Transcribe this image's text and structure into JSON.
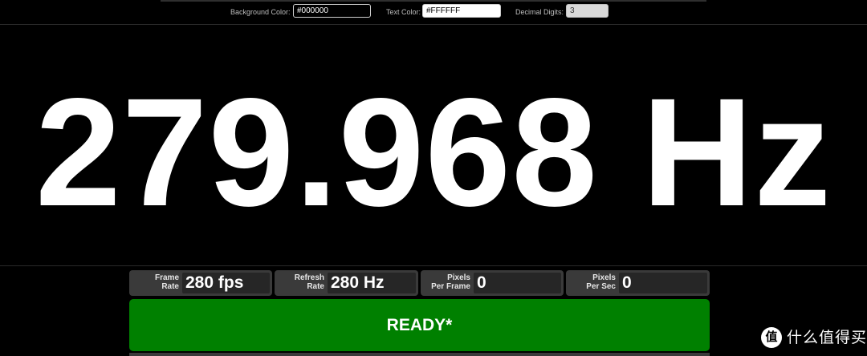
{
  "settings": {
    "background_color_label": "Background Color:",
    "background_color_value": "#000000",
    "text_color_label": "Text Color:",
    "text_color_value": "#FFFFFF",
    "decimal_digits_label": "Decimal Digits:",
    "decimal_digits_value": "3"
  },
  "readout": {
    "value": "279.968 Hz"
  },
  "stats": [
    {
      "label_line1": "Frame",
      "label_line2": "Rate",
      "value": "280 fps"
    },
    {
      "label_line1": "Refresh",
      "label_line2": "Rate",
      "value": "280 Hz"
    },
    {
      "label_line1": "Pixels",
      "label_line2": "Per Frame",
      "value": "0"
    },
    {
      "label_line1": "Pixels",
      "label_line2": "Per Sec",
      "value": "0"
    }
  ],
  "status_button": {
    "label": "READY*"
  },
  "watermark": {
    "logo_glyph": "值",
    "text": "什么值得买"
  },
  "colors": {
    "background": "#000000",
    "text": "#FFFFFF",
    "ready_green": "#008000",
    "stat_box": "#3a3a3a"
  }
}
